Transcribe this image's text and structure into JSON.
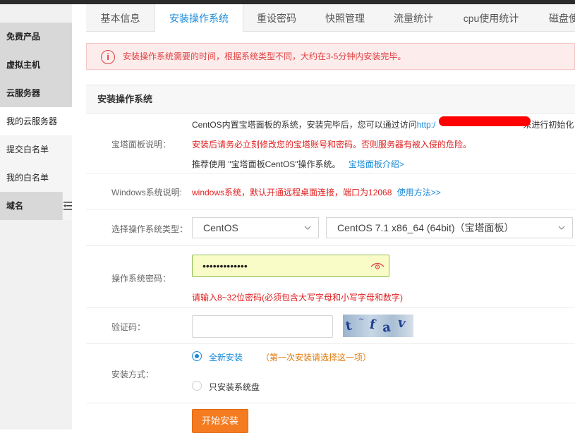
{
  "sidebar": {
    "items": [
      {
        "label": "免费产品"
      },
      {
        "label": "虚拟主机"
      },
      {
        "label": "云服务器"
      },
      {
        "label": "我的云服务器"
      },
      {
        "label": "提交白名单"
      },
      {
        "label": "我的白名单"
      },
      {
        "label": "域名"
      }
    ]
  },
  "tabs": [
    {
      "label": "基本信息"
    },
    {
      "label": "安装操作系统"
    },
    {
      "label": "重设密码"
    },
    {
      "label": "快照管理"
    },
    {
      "label": "流量统计"
    },
    {
      "label": "cpu使用统计"
    },
    {
      "label": "磁盘使"
    }
  ],
  "alert": {
    "icon": "i",
    "text": "安装操作系统需要的时间，根据系统类型不同，大约在3-5分钟内安装完毕。"
  },
  "panel": {
    "title": "安装操作系统",
    "bt_panel": {
      "label": "宝塔面板说明：",
      "line1_prefix": "CentOS内置宝塔面板的系统，安装完毕后，您可以通过访问",
      "line1_link": "http:/",
      "line1_suffix": "来进行初始化",
      "line2": "安装后请务必立刻修改您的宝塔账号和密码。否则服务器有被入侵的危险。",
      "line3_prefix": "推荐使用 \"宝塔面板CentOS\"操作系统。",
      "line3_link": "宝塔面板介绍>"
    },
    "windows": {
      "label": "Windows系统说明:",
      "text": "windows系统，默认开通远程桌面连接，端口为12068",
      "link": "使用方法>>"
    },
    "os_type": {
      "label": "选择操作系统类型：",
      "family": "CentOS",
      "version": "CentOS 7.1 x86_64 (64bit)（宝塔面板）"
    },
    "password": {
      "label": "操作系统密码：",
      "value": "•••••••••••••",
      "hint": "请输入8~32位密码(必须包含大写字母和小写字母和数字)"
    },
    "captcha": {
      "label": "验证码：",
      "value": "",
      "image_text": "tfav"
    },
    "install_mode": {
      "label": "安装方式：",
      "option1": "全新安装",
      "option1_note": "（第一次安装请选择这一项）",
      "option2": "只安装系统盘"
    },
    "submit_label": "开始安装"
  },
  "colors": {
    "accent": "#1a8ad9",
    "danger": "#e02020",
    "button": "#f47b1f"
  }
}
